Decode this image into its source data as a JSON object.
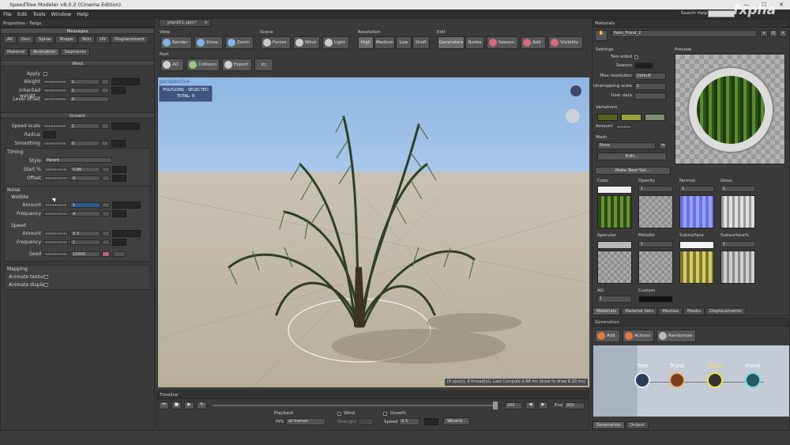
{
  "window": {
    "title": "SpeedTree Modeler v8.0.2 (Cinema Edition)",
    "controls": [
      "—",
      "☐",
      "✕"
    ]
  },
  "menu": [
    "File",
    "Edit",
    "Tools",
    "Window",
    "Help"
  ],
  "search_help": "Search Help:",
  "watermark": "fxpha",
  "left_panel": {
    "title": "Properties - Twigs",
    "messages": "Messages",
    "tabs_row1": [
      "All",
      "Gen",
      "Spine",
      "Shape",
      "Skin",
      "UV",
      "Displacement"
    ],
    "tabs_row2": [
      "Material",
      "Animation",
      "Segments"
    ],
    "wind": {
      "header": "Wind",
      "rows": [
        {
          "label": "Apply",
          "value": ""
        },
        {
          "label": "Weight",
          "value": "1"
        },
        {
          "label": "Inherited weight...",
          "value": "1"
        },
        {
          "label": "Level offset",
          "value": "0"
        }
      ]
    },
    "growth": {
      "header": "Growth",
      "rows": [
        {
          "label": "Speed scale",
          "value": "1"
        },
        {
          "label": "Radius",
          "value": ""
        },
        {
          "label": "Smoothing",
          "value": "0"
        }
      ]
    },
    "timing": {
      "header": "Timing",
      "style_label": "Style",
      "style_value": "Parent",
      "start_label": "Start %",
      "start_value": "0.86",
      "offset_label": "Offset",
      "offset_value": "0"
    },
    "noise": {
      "header": "Noise",
      "wobble": "Wobble",
      "amount_label": "Amount",
      "amount_value": "1",
      "frequency_label": "Frequency",
      "frequency_value": "4",
      "speed": "Speed",
      "speed_amount_value": "0.3",
      "speed_frequency_value": "1",
      "seed_label": "Seed",
      "seed_value": "15000"
    },
    "mapping": {
      "header": "Mapping",
      "animate_texture": "Animate texture",
      "animate_displace": "Animate displa..."
    }
  },
  "doc_tab": "plant01.spm*",
  "toolbar": {
    "view": {
      "label": "View",
      "buttons": [
        "Render",
        "Show",
        "Zoom"
      ]
    },
    "scene": {
      "label": "Scene",
      "buttons": [
        "Forces",
        "Wind",
        "Light"
      ]
    },
    "resolution": {
      "label": "Resolution",
      "buttons": [
        "High",
        "Medium",
        "Low",
        "Draft"
      ]
    },
    "edit": {
      "label": "Edit",
      "buttons": [
        "Generators",
        "Nodes",
        "Season",
        "Add",
        "Visibility"
      ]
    },
    "post": {
      "label": "Post",
      "buttons": [
        "AO",
        "Collision",
        "Export"
      ]
    }
  },
  "viewport": {
    "label": "perspective",
    "info_line1": "POLYGONS - SELECTED",
    "info_line2": "TOTAL: 0",
    "status": "(9 cpu(s), 8 thread(s)), Last Compute 0.88 ms (draw to draw 8.20 ms)"
  },
  "timeline": {
    "title": "Timeline",
    "frame_value": "200",
    "end_label": "End",
    "end_value": "300",
    "playback_label": "Playback",
    "fps_label": "FPS",
    "fps_value": "all frames",
    "wind_label": "Wind",
    "strength_label": "Strength",
    "growth_label": "Growth",
    "speed_label": "Speed",
    "speed_value": "0.3",
    "wizard_label": "Wizard..."
  },
  "materials": {
    "title": "Materials",
    "name": "Palm_Frond_2",
    "settings_label": "Settings",
    "preview_label": "Preview",
    "two_sided": "Two-sided",
    "season": "Season",
    "max_resolution": "Max resolution",
    "max_resolution_value": "Default",
    "unwrapping_scale": "Unwrapping scale",
    "unwrapping_value": "1",
    "user_data": "User data",
    "variations": "Variations",
    "amount": "Amount",
    "mesh": "Mesh",
    "mesh_value": "None",
    "edit_btn": "Edit...",
    "make_new_set": "Make New Set...",
    "maps": [
      "Color",
      "Opacity",
      "Normal",
      "Gloss",
      "Specular",
      "Metallic",
      "Subsurface",
      "Subsurface%",
      "AO",
      "Custom"
    ],
    "map_values": [
      "1",
      "1",
      "1",
      "1",
      "1",
      "1",
      "1"
    ],
    "bottom_tabs": [
      "Materials",
      "Material Sets",
      "Meshes",
      "Masks",
      "Displacements"
    ]
  },
  "generation": {
    "title": "Generation",
    "buttons": [
      "Add",
      "Actions",
      "Randomize"
    ],
    "nodes": [
      "Tree",
      "Trunk",
      "Twigs",
      "Frond"
    ],
    "node_colors": [
      "#dfeaf5",
      "#e7b27a",
      "#f2e24b",
      "#7ed4d8"
    ],
    "bottom_tabs": [
      "Generation",
      "Output"
    ]
  }
}
